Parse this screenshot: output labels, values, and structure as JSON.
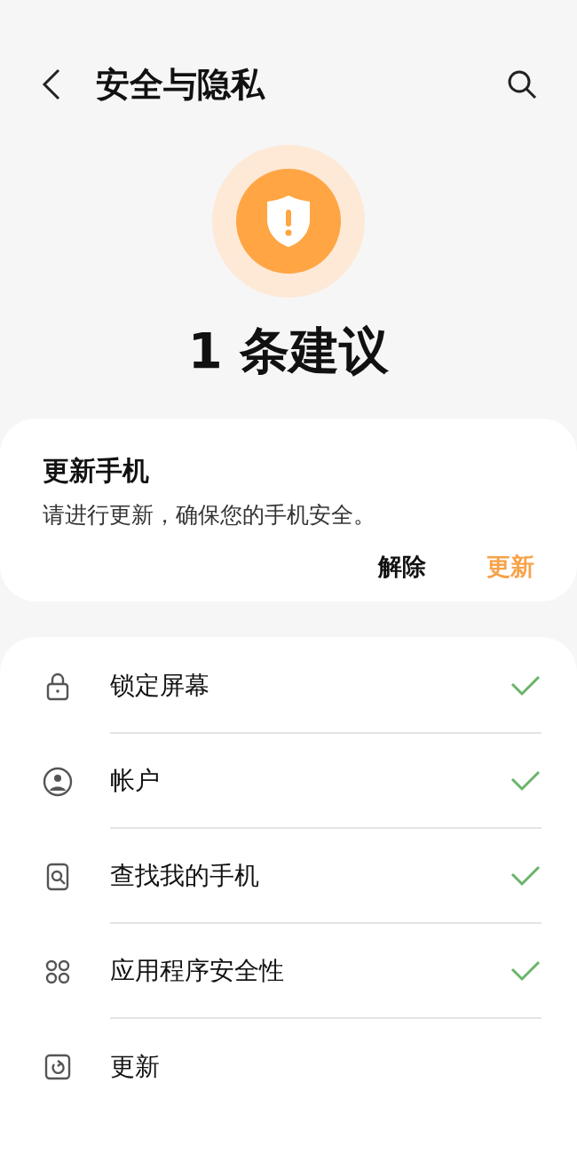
{
  "header": {
    "title": "安全与隐私"
  },
  "status": {
    "kind": "warning",
    "headline": "1 条建议"
  },
  "suggestion": {
    "title": "更新手机",
    "body": "请进行更新，确保您的手机安全。",
    "actions": [
      {
        "label": "解除",
        "kind": "dismiss"
      },
      {
        "label": "更新",
        "kind": "primary"
      }
    ]
  },
  "items": [
    {
      "kind": "lock",
      "label": "锁定屏幕",
      "checked": true
    },
    {
      "kind": "account",
      "label": "帐户",
      "checked": true
    },
    {
      "kind": "find",
      "label": "查找我的手机",
      "checked": true
    },
    {
      "kind": "apps",
      "label": "应用程序安全性",
      "checked": true
    },
    {
      "kind": "update",
      "label": "更新",
      "checked": false
    }
  ]
}
